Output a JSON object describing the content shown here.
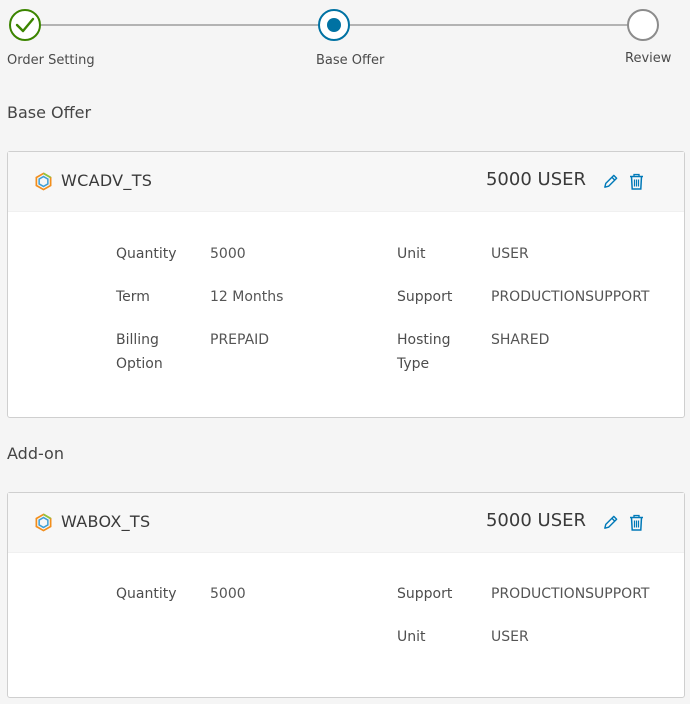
{
  "stepper": {
    "steps": [
      {
        "label": "Order Setting",
        "state": "complete"
      },
      {
        "label": "Base Offer",
        "state": "current"
      },
      {
        "label": "Review",
        "state": "pending"
      }
    ]
  },
  "base_offer": {
    "section_title": "Base Offer",
    "product_name": "WCADV_TS",
    "summary": "5000 USER",
    "fields": {
      "quantity_label": "Quantity",
      "quantity_value": "5000",
      "unit_label": "Unit",
      "unit_value": "USER",
      "term_label": "Term",
      "term_value": "12 Months",
      "support_label": "Support",
      "support_value": "PRODUCTIONSUPPORT",
      "billing_label_1": "Billing",
      "billing_label_2": "Option",
      "billing_value": "PREPAID",
      "hosting_label_1": "Hosting",
      "hosting_label_2": "Type",
      "hosting_value": "SHARED"
    }
  },
  "addon": {
    "section_title": "Add-on",
    "product_name": "WABOX_TS",
    "summary": "5000 USER",
    "fields": {
      "quantity_label": "Quantity",
      "quantity_value": "5000",
      "support_label": "Support",
      "support_value": "PRODUCTIONSUPPORT",
      "unit_label": "Unit",
      "unit_value": "USER"
    }
  },
  "colors": {
    "complete": "#3c8500",
    "current": "#0072a3",
    "pending": "#8c8c8c",
    "action_icon": "#0079b8"
  },
  "icons": {
    "complete": "check-circle-icon",
    "current": "dot-circle-icon",
    "pending": "empty-circle-icon",
    "product": "hexagon-logo-icon",
    "edit": "pencil-icon",
    "delete": "trash-icon"
  }
}
